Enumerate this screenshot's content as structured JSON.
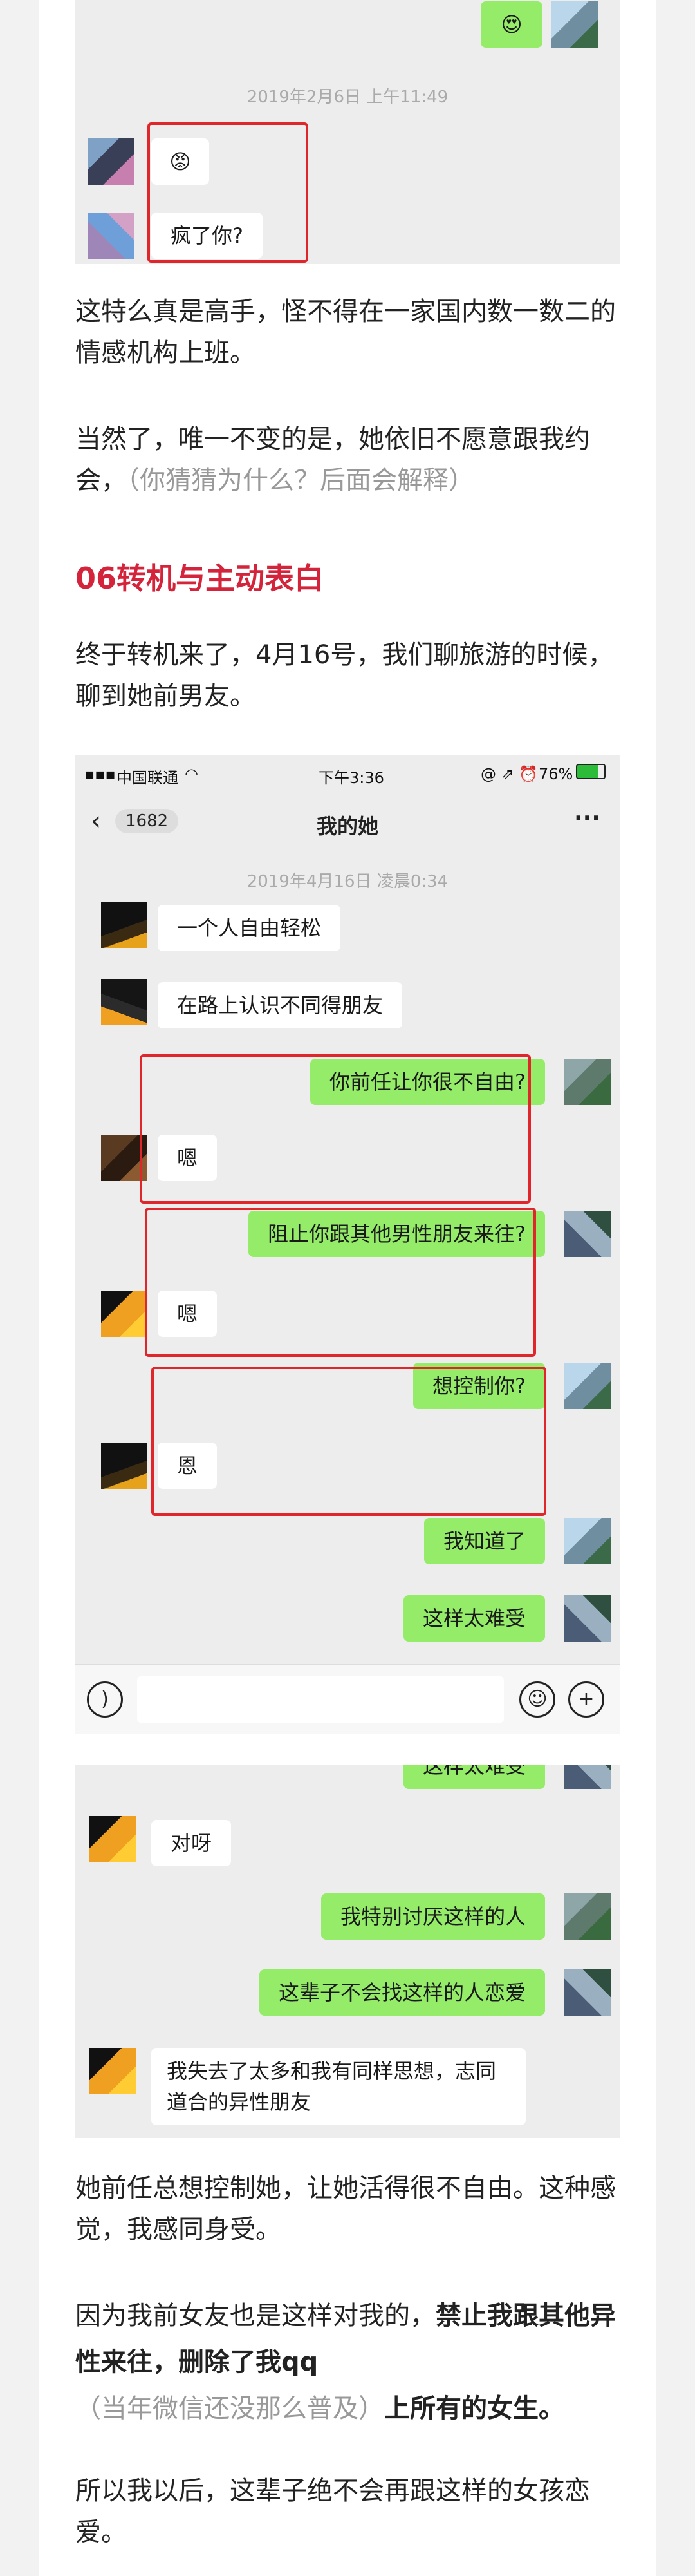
{
  "shot1": {
    "timestamp": "2019年2月6日 上午11:49",
    "msg_reply": "疯了你?",
    "emoji_out": "😍",
    "emoji_in": "😡"
  },
  "para1": "这特么真是高手，怪不得在一家国内数一数二的情感机构上班。",
  "para2_main": "当然了，唯一不变的是，她依旧不愿意跟我约会，",
  "para2_gray": "（你猜猜为什么？后面会解释）",
  "heading1": "06转机与主动表白",
  "para3": "终于转机来了，4月16号，我们聊旅游的时候，聊到她前男友。",
  "shot2": {
    "status": {
      "carrier": "中国联通",
      "time": "下午3:36",
      "battery": "76%"
    },
    "nav": {
      "back_count": "1682",
      "title": "我的她",
      "more": "···"
    },
    "timestamp": "2019年4月16日 凌晨0:34",
    "messages": [
      "一个人自由轻松",
      "在路上认识不同得朋友",
      "你前任让你很不自由?",
      "嗯",
      "阻止你跟其他男性朋友来往?",
      "嗯",
      "想控制你?",
      "恩",
      "我知道了",
      "这样太难受"
    ]
  },
  "shot3": {
    "messages": [
      "这样太难受",
      "对呀",
      "我特别讨厌这样的人",
      "这辈子不会找这样的人恋爱",
      "我失去了太多和我有同样思想，志同道合的异性朋友"
    ]
  },
  "para4": "她前任总想控制她，让她活得很不自由。这种感觉，我感同身受。",
  "para5": {
    "t1": "因为我前女友也是这样对我的，",
    "b1": "禁止我跟其他异性来往，删除了我qq",
    "g1": "（当年微信还没那么普及）",
    "b2": "上所有的女生。"
  },
  "para6": "所以我以后，这辈子绝不会再跟这样的女孩恋爱。"
}
